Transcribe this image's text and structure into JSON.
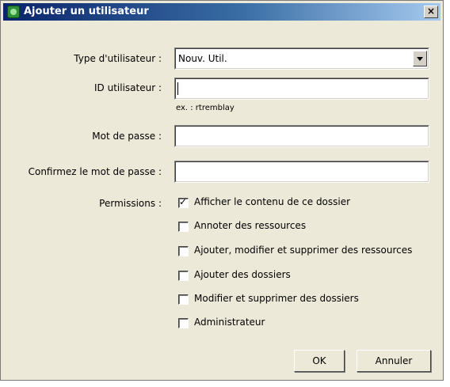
{
  "window": {
    "title": "Ajouter un utilisateur",
    "close_label": "×"
  },
  "form": {
    "type_label": "Type d'utilisateur :",
    "type_value": "Nouv. Util.",
    "id_label": "ID utilisateur :",
    "id_value": "",
    "id_hint": "ex. : rtremblay",
    "password_label": "Mot de passe :",
    "confirm_label": "Confirmez le mot de passe :",
    "permissions_label": "Permissions :"
  },
  "permissions": [
    {
      "label": "Afficher le contenu de ce dossier",
      "checked": true
    },
    {
      "label": "Annoter des ressources",
      "checked": false
    },
    {
      "label": "Ajouter, modifier et supprimer des ressources",
      "checked": false
    },
    {
      "label": "Ajouter des dossiers",
      "checked": false
    },
    {
      "label": "Modifier et supprimer des dossiers",
      "checked": false
    },
    {
      "label": "Administrateur",
      "checked": false
    }
  ],
  "buttons": {
    "ok": "OK",
    "cancel": "Annuler"
  }
}
